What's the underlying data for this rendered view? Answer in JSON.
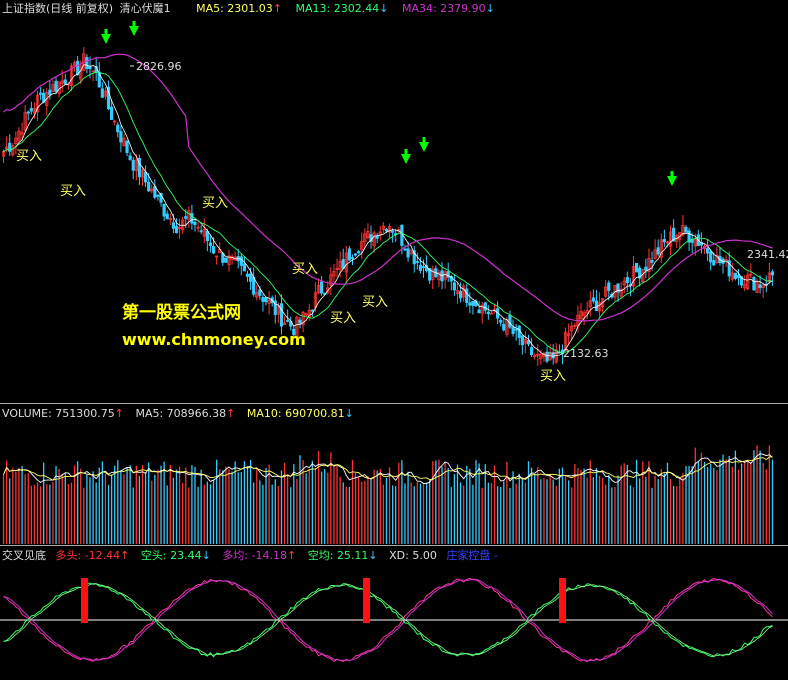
{
  "colors": {
    "bg": "#000000",
    "up": "#ff3333",
    "down": "#33ccff",
    "ma5": "#ffffff",
    "ma13": "#33ff66",
    "ma34": "#cc33cc",
    "buy": "#ffff66",
    "grid": "#888888",
    "arrow_green": "#00ff00"
  },
  "price_panel": {
    "title": "上证指数(日线 前复权)",
    "indicator": "清心伏魔1",
    "ma5": "MA5: 2301.03",
    "ma5_dir": "↑",
    "ma13": "MA13: 2302.44",
    "ma13_dir": "↓",
    "ma34": "MA34: 2379.90",
    "ma34_dir": "↓",
    "high_label": "2826.96",
    "low_label": "2132.63",
    "last_label": "2341.42",
    "buy_label": "买入",
    "buy_count": 9
  },
  "volume_panel": {
    "volume": "VOLUME: 751300.75",
    "volume_dir": "↑",
    "ma5": "MA5: 708966.38",
    "ma5_dir": "↑",
    "ma10": "MA10: 690700.81",
    "ma10_dir": "↓"
  },
  "cross_panel": {
    "title": "交叉见底",
    "long": "多头: -12.44",
    "long_dir": "↑",
    "short": "空头: 23.44",
    "short_dir": "↓",
    "long_avg": "多均: -14.18",
    "long_avg_dir": "↑",
    "short_avg": "空均: 25.11",
    "short_avg_dir": "↓",
    "xd": "XD: 5.00",
    "banker": "庄家控盘",
    "banker_suffix": " -"
  },
  "watermark": {
    "line1": "第一股票公式网",
    "line2": "www.chnmoney.com"
  },
  "chart_data": [
    {
      "type": "candlestick",
      "title": "上证指数(日线 前复权)",
      "series": [
        {
          "name": "MA5",
          "last": 2301.03
        },
        {
          "name": "MA13",
          "last": 2302.44
        },
        {
          "name": "MA34",
          "last": 2379.9
        }
      ],
      "annotations": [
        {
          "text": "2826.96",
          "kind": "high"
        },
        {
          "text": "2132.63",
          "kind": "low"
        },
        {
          "text": "2341.42",
          "kind": "last"
        },
        {
          "text": "买入",
          "kind": "buy_signal",
          "count": 9
        }
      ],
      "close": [
        2620,
        2650,
        2700,
        2740,
        2760,
        2780,
        2800,
        2826,
        2790,
        2720,
        2660,
        2600,
        2560,
        2520,
        2480,
        2450,
        2470,
        2440,
        2400,
        2380,
        2360,
        2330,
        2300,
        2270,
        2240,
        2220,
        2250,
        2300,
        2330,
        2360,
        2400,
        2420,
        2440,
        2460,
        2430,
        2390,
        2360,
        2340,
        2330,
        2310,
        2290,
        2270,
        2250,
        2230,
        2200,
        2170,
        2150,
        2140,
        2180,
        2230,
        2260,
        2280,
        2300,
        2320,
        2340,
        2360,
        2390,
        2420,
        2440,
        2430,
        2410,
        2380,
        2360,
        2340,
        2330,
        2320,
        2341
      ]
    },
    {
      "type": "bar",
      "title": "VOLUME",
      "series": [
        {
          "name": "VOLUME",
          "last": 751300.75
        },
        {
          "name": "MA5",
          "last": 708966.38
        },
        {
          "name": "MA10",
          "last": 690700.81
        }
      ]
    },
    {
      "type": "line",
      "title": "交叉见底",
      "series": [
        {
          "name": "多头",
          "last": -12.44
        },
        {
          "name": "空头",
          "last": 23.44
        },
        {
          "name": "多均",
          "last": -14.18
        },
        {
          "name": "空均",
          "last": 25.11
        }
      ]
    }
  ]
}
